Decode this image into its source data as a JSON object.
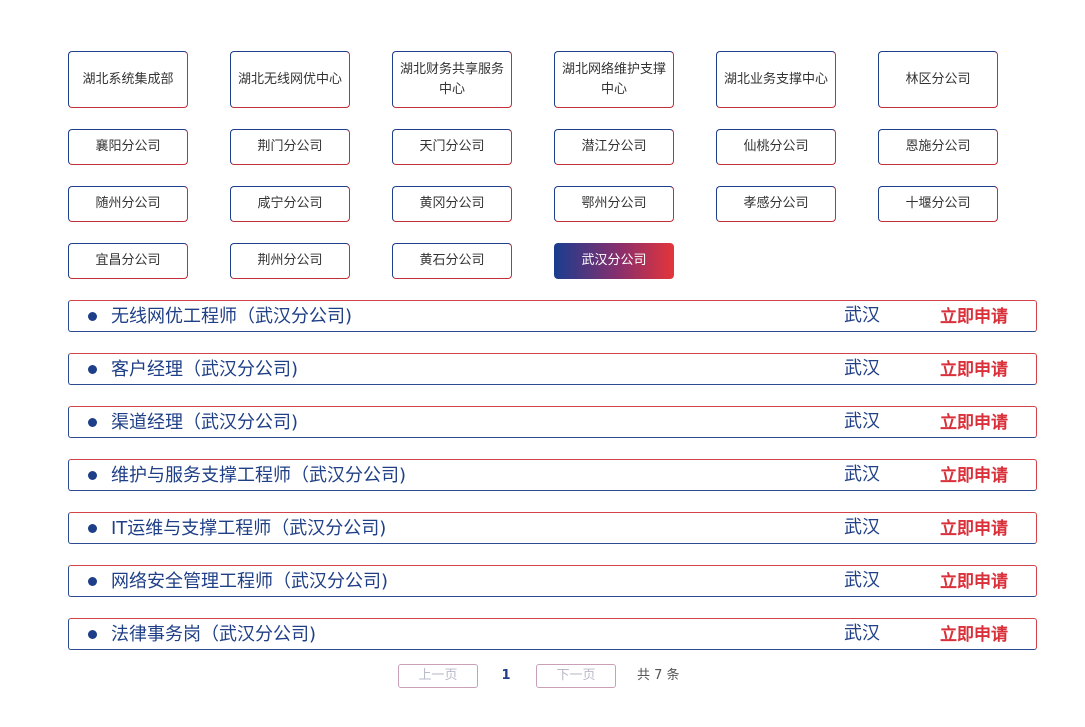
{
  "departments": [
    {
      "label": "湖北系统集成部"
    },
    {
      "label": "湖北无线网优中心"
    },
    {
      "label": "湖北财务共享服务中心"
    },
    {
      "label": "湖北网络维护支撑中心"
    },
    {
      "label": "湖北业务支撑中心"
    },
    {
      "label": "林区分公司"
    },
    {
      "label": "襄阳分公司"
    },
    {
      "label": "荆门分公司"
    },
    {
      "label": "天门分公司"
    },
    {
      "label": "潜江分公司"
    },
    {
      "label": "仙桃分公司"
    },
    {
      "label": "恩施分公司"
    },
    {
      "label": "随州分公司"
    },
    {
      "label": "咸宁分公司"
    },
    {
      "label": "黄冈分公司"
    },
    {
      "label": "鄂州分公司"
    },
    {
      "label": "孝感分公司"
    },
    {
      "label": "十堰分公司"
    },
    {
      "label": "宜昌分公司"
    },
    {
      "label": "荆州分公司"
    },
    {
      "label": "黄石分公司"
    },
    {
      "label": "武汉分公司",
      "active": true
    }
  ],
  "jobs": [
    {
      "title": "无线网优工程师（武汉分公司)",
      "city": "武汉",
      "apply": "立即申请"
    },
    {
      "title": "客户经理（武汉分公司)",
      "city": "武汉",
      "apply": "立即申请"
    },
    {
      "title": "渠道经理（武汉分公司)",
      "city": "武汉",
      "apply": "立即申请"
    },
    {
      "title": "维护与服务支撑工程师（武汉分公司)",
      "city": "武汉",
      "apply": "立即申请"
    },
    {
      "title": "IT运维与支撑工程师（武汉分公司)",
      "city": "武汉",
      "apply": "立即申请"
    },
    {
      "title": "网络安全管理工程师（武汉分公司)",
      "city": "武汉",
      "apply": "立即申请"
    },
    {
      "title": "法律事务岗（武汉分公司)",
      "city": "武汉",
      "apply": "立即申请"
    }
  ],
  "pagination": {
    "prev_label": "上一页",
    "current_page": "1",
    "next_label": "下一页",
    "total_text": "共 7 条"
  },
  "colors": {
    "brand_blue": "#1f3f86",
    "brand_red": "#d9303a"
  }
}
